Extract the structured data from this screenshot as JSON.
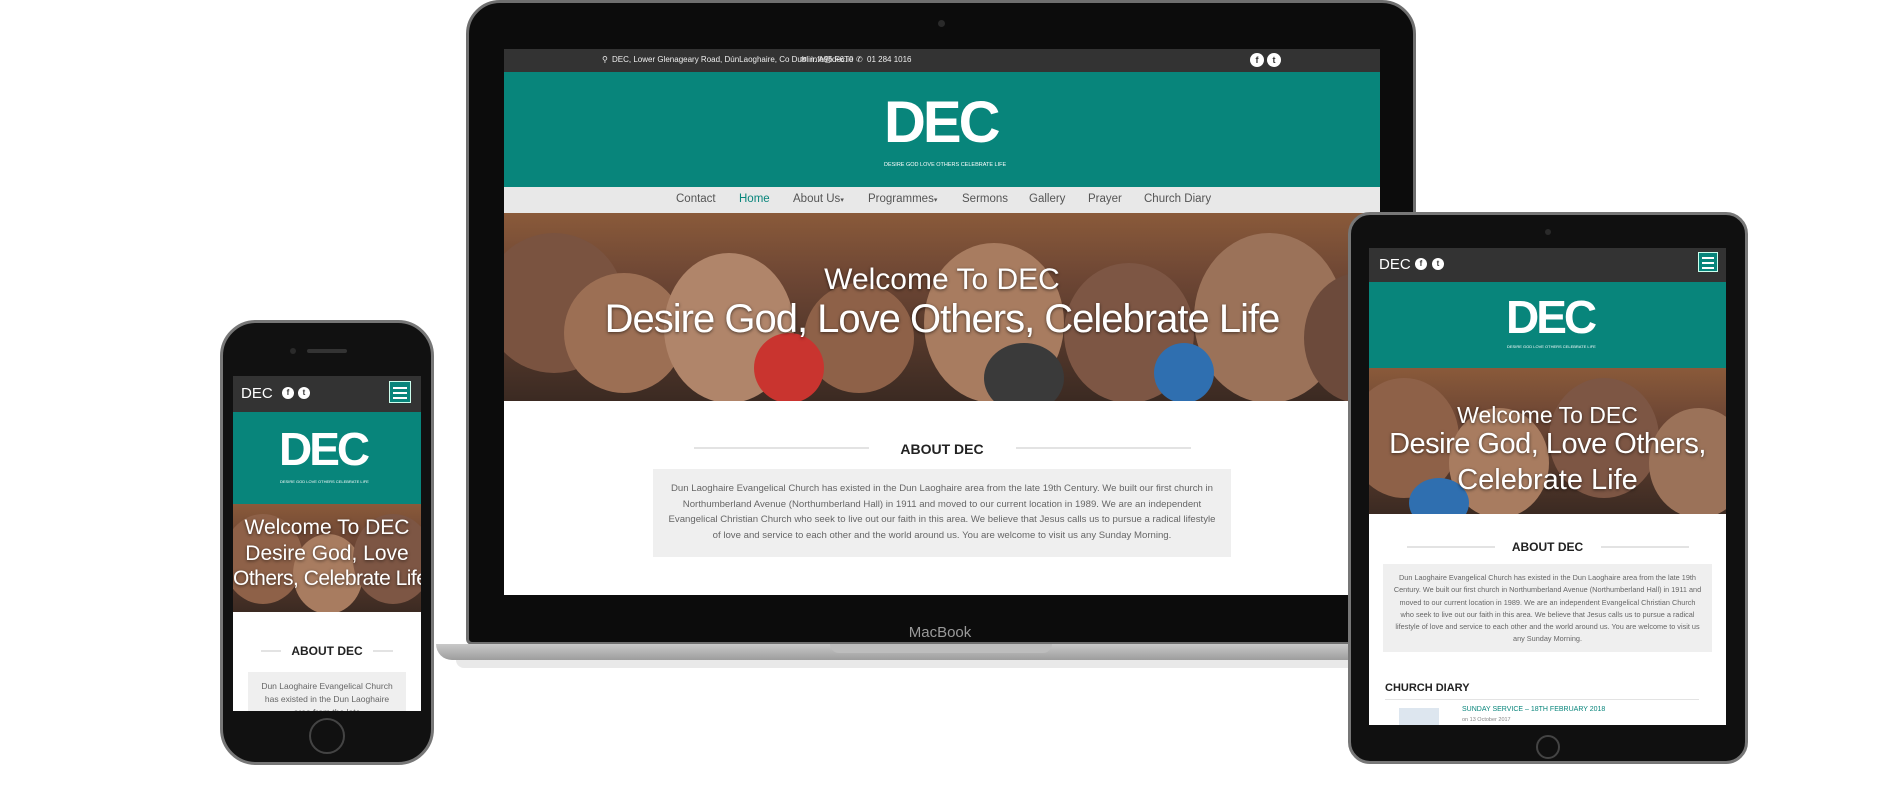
{
  "site": {
    "brand": "DEC",
    "logo_text": "DEC",
    "logo_tagline": "DESIRE GOD LOVE OTHERS CELEBRATE LIFE",
    "address": "DEC, Lower Glenageary Road, DúnLaoghaire, Co Dublin. A96 F6T0",
    "email": "info@dec.ie",
    "phone": "01 284 1016",
    "social": [
      "f",
      "t"
    ],
    "nav": [
      "Contact",
      "Home",
      "About Us",
      "Programmes",
      "Sermons",
      "Gallery",
      "Prayer",
      "Church Diary"
    ],
    "nav_active": "Home",
    "nav_dropdown_mark": "▾",
    "hero": {
      "line1": "Welcome To DEC",
      "line2": "Desire God, Love Others, Celebrate Life",
      "phone_line2a": "Desire God, Love",
      "phone_line2b": "Others, Celebrate Life",
      "tablet_line2a": "Desire God, Love Others,",
      "tablet_line2b": "Celebrate Life"
    },
    "about_title": "ABOUT DEC",
    "about_text": "Dun Laoghaire Evangelical Church has existed in the Dun Laoghaire area from the late 19th Century.  We built our first church in Northumberland Avenue (Northumberland Hall) in 1911 and moved to our current location in 1989. We are an independent Evangelical Christian Church who seek to live out our faith in this area. We believe that Jesus calls us to pursue a radical lifestyle of love and service to each other and the world around us.  You are welcome to visit us any Sunday Morning.",
    "phone_about_text": "Dun Laoghaire Evangelical Church has existed in the Dun Laoghaire area from the late",
    "diary_title": "CHURCH DIARY",
    "diary_item": "SUNDAY SERVICE – 18TH FEBRUARY 2018",
    "diary_date": "on 13 October 2017"
  },
  "devices": {
    "laptop_label": "MacBook"
  },
  "icons": {
    "pin": "map-pin-icon",
    "mail": "envelope-icon",
    "phone": "phone-icon",
    "menu": "hamburger-menu-icon",
    "facebook": "facebook-icon",
    "twitter": "twitter-icon"
  },
  "colors": {
    "teal": "#08857b",
    "topbar": "#333333",
    "nav_bg": "#e8e8e8"
  }
}
